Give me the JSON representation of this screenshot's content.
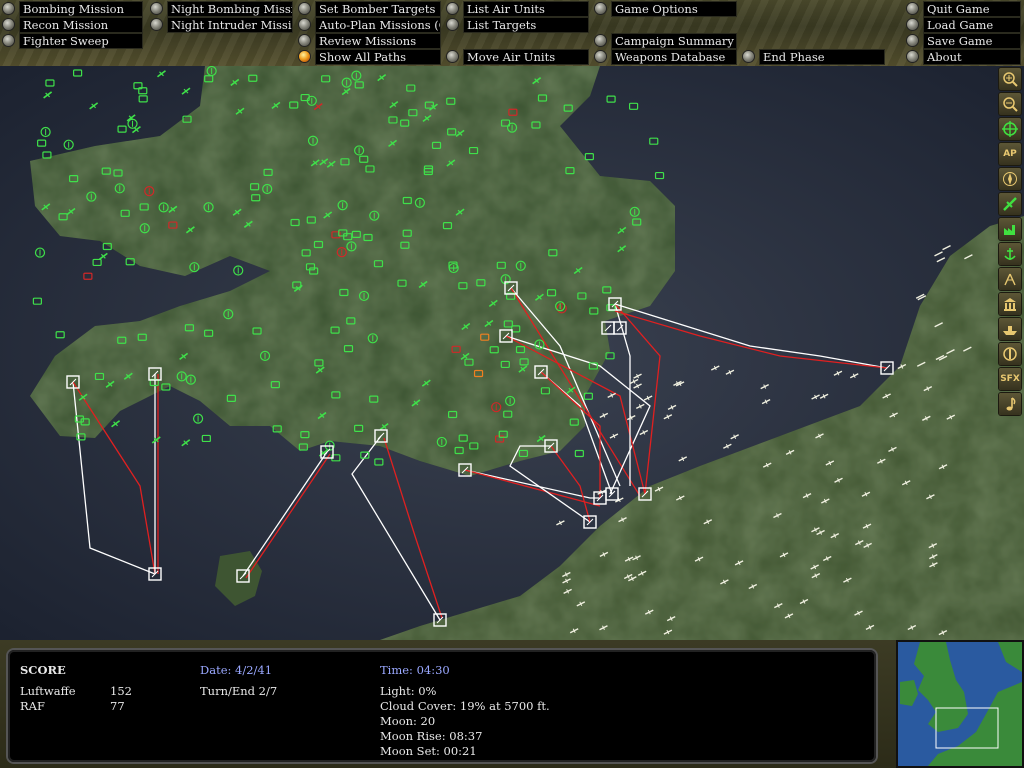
{
  "menu": {
    "bombing_mission": "Bombing Mission",
    "recon_mission": "Recon Mission",
    "fighter_sweep": "Fighter Sweep",
    "night_bombing_mission": "Night Bombing Mission",
    "night_intruder_mission": "Night Intruder Mission",
    "set_bomber_targets": "Set Bomber Targets",
    "auto_plan_missions": "Auto-Plan Missions (Off)",
    "review_missions": "Review Missions",
    "show_all_paths": "Show All Paths",
    "list_air_units": "List Air Units",
    "list_targets": "List Targets",
    "move_air_units": "Move Air Units",
    "game_options": "Game Options",
    "campaign_summary": "Campaign Summary",
    "weapons_database": "Weapons Database",
    "end_phase": "End Phase",
    "quit_game": "Quit Game",
    "load_game": "Load Game",
    "save_game": "Save Game",
    "about": "About"
  },
  "tools": {
    "zoom_in": "zoom-in-icon",
    "zoom_out": "zoom-out-icon",
    "center": "crosshair-icon",
    "ap": "AP",
    "compass": "compass-icon",
    "airfield": "airfield-icon",
    "factory": "factory-icon",
    "anchor": "anchor-icon",
    "radar": "radar-icon",
    "bank": "bank-icon",
    "ship": "ship-icon",
    "target": "target-icon",
    "sfx": "SFX",
    "music": "music-note-icon"
  },
  "status": {
    "score_title": "SCORE",
    "luftwaffe_label": "Luftwaffe",
    "luftwaffe_score": "152",
    "raf_label": "RAF",
    "raf_score": "77",
    "date": "Date: 4/2/41",
    "turn": "Turn/End 2/7",
    "time": "Time: 04:30",
    "light": "Light: 0%",
    "cloud_cover": "Cloud Cover: 19% at 5700 ft.",
    "moon": "Moon: 20",
    "moon_rise": "Moon Rise: 08:37",
    "moon_set": "Moon Set: 00:21"
  },
  "colors": {
    "friendly_unit": "#3fe04a",
    "enemy_unit": "#d02828",
    "highlight_unit": "#f08020",
    "german_unit": "#f0f0e0",
    "path_white": "#ffffff",
    "path_red": "#e02020",
    "label_blue": "#9aa8ff"
  }
}
